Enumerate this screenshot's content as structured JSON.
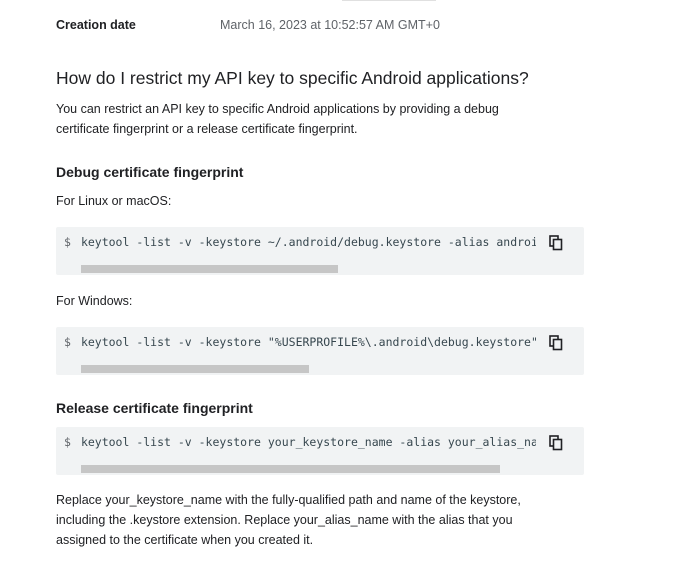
{
  "creation": {
    "label": "Creation date",
    "value": "March 16, 2023 at 10:52:57 AM GMT+0"
  },
  "faq": {
    "title": "How do I restrict my API key to specific Android applications?",
    "intro_line1": "You can restrict an API key to specific Android applications by providing a debug",
    "intro_line2": "certificate fingerprint or a release certificate fingerprint."
  },
  "debug": {
    "heading": "Debug certificate fingerprint",
    "linux_label": "For Linux or macOS:",
    "linux_command": "keytool -list -v -keystore ~/.android/debug.keystore -alias androiddebugkey -storepass android -keypass android",
    "windows_label": "For Windows:",
    "windows_command": "keytool -list -v -keystore \"%USERPROFILE%\\.android\\debug.keystore\" -alias androiddebugkey -storepass android -keypass android"
  },
  "release": {
    "heading": "Release certificate fingerprint",
    "command": "keytool -list -v -keystore your_keystore_name -alias your_alias_name"
  },
  "code": {
    "prompt": "$",
    "copy_icon": "copy-icon"
  },
  "footer": {
    "line1": "Replace your_keystore_name with the fully-qualified path and name of the keystore,",
    "line2": "including the .keystore extension. Replace your_alias_name with the alias that you",
    "line3": "assigned to the certificate when you created it."
  }
}
